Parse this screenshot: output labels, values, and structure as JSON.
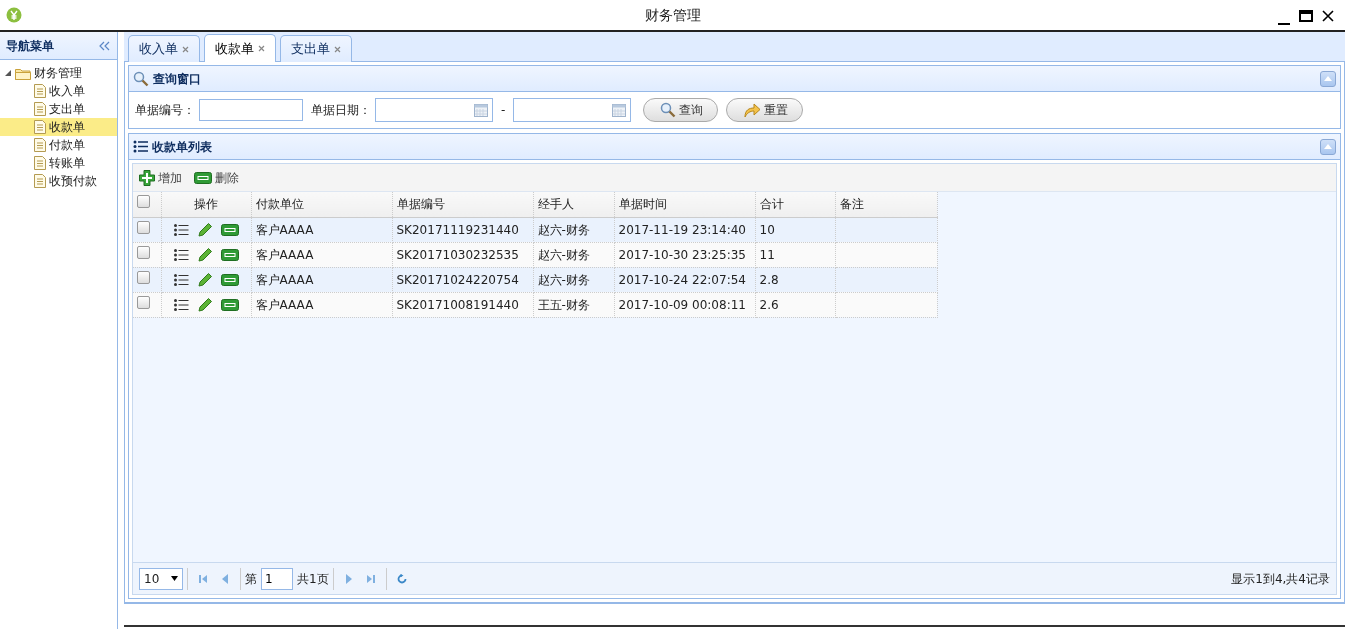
{
  "window": {
    "title": "财务管理"
  },
  "sidebar": {
    "title": "导航菜单",
    "tree": [
      {
        "label": "财务管理",
        "expanded": true,
        "children": [
          {
            "label": "收入单",
            "selected": false
          },
          {
            "label": "支出单",
            "selected": false
          },
          {
            "label": "收款单",
            "selected": true
          },
          {
            "label": "付款单",
            "selected": false
          },
          {
            "label": "转账单",
            "selected": false
          },
          {
            "label": "收预付款",
            "selected": false
          }
        ]
      }
    ]
  },
  "tabs": [
    {
      "label": "收入单",
      "selected": false
    },
    {
      "label": "收款单",
      "selected": true
    },
    {
      "label": "支出单",
      "selected": false
    }
  ],
  "query_panel": {
    "title": "查询窗口",
    "number_label": "单据编号：",
    "date_label": "单据日期：",
    "date_separator": "-",
    "buttons": [
      {
        "label": "查询",
        "kind": "search"
      },
      {
        "label": "重置",
        "kind": "reset"
      }
    ]
  },
  "list_panel": {
    "title": "收款单列表",
    "toolbar": [
      {
        "label": "增加",
        "kind": "add"
      },
      {
        "label": "删除",
        "kind": "delete"
      }
    ],
    "table": {
      "header_checked": false,
      "action_column": "操作",
      "columns": [
        "付款单位",
        "单据编号",
        "经手人",
        "单据时间",
        "合计",
        "备注"
      ],
      "rows": [
        {
          "checked": false,
          "cells": [
            "客户AAAA",
            "SK20171119231440",
            "赵六-财务",
            "2017-11-19 23:14:40",
            "10"
          ]
        },
        {
          "checked": false,
          "cells": [
            "客户AAAA",
            "SK20171030232535",
            "赵六-财务",
            "2017-10-30 23:25:35",
            "11"
          ]
        },
        {
          "checked": false,
          "cells": [
            "客户AAAA",
            "SK20171024220754",
            "赵六-财务",
            "2017-10-24 22:07:54",
            "2.8"
          ]
        },
        {
          "checked": false,
          "cells": [
            "客户AAAA",
            "SK20171008191440",
            "王五-财务",
            "2017-10-09 00:08:11",
            "2.6"
          ]
        }
      ]
    },
    "pager": {
      "page_size": "10",
      "page_prefix": "第",
      "page": "1",
      "total_pages": "共1页",
      "summary": "显示1到4,共4记录"
    }
  }
}
